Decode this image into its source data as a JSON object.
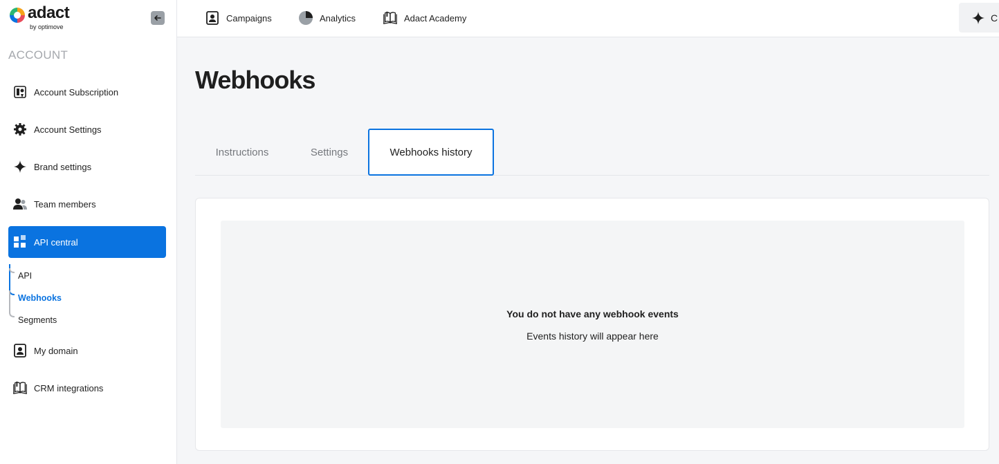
{
  "brand": {
    "name": "adact",
    "byline": "by optimove"
  },
  "sidebar": {
    "section_title": "ACCOUNT",
    "items": [
      {
        "label": "Account Subscription",
        "icon": "subscription-icon"
      },
      {
        "label": "Account Settings",
        "icon": "gear-icon"
      },
      {
        "label": "Brand settings",
        "icon": "sparkle-icon"
      },
      {
        "label": "Team members",
        "icon": "team-icon"
      },
      {
        "label": "API central",
        "icon": "grid-icon",
        "active": true
      },
      {
        "label": "My domain",
        "icon": "domain-icon"
      },
      {
        "label": "CRM integrations",
        "icon": "book-icon"
      }
    ],
    "subitems": [
      {
        "label": "API"
      },
      {
        "label": "Webhooks",
        "active": true
      },
      {
        "label": "Segments"
      }
    ]
  },
  "topbar": {
    "links": [
      {
        "label": "Campaigns",
        "icon": "campaigns-icon"
      },
      {
        "label": "Analytics",
        "icon": "pie-chart-icon"
      },
      {
        "label": "Adact Academy",
        "icon": "book-icon"
      }
    ],
    "ai_label": "C"
  },
  "page": {
    "title": "Webhooks",
    "tabs": [
      {
        "label": "Instructions"
      },
      {
        "label": "Settings"
      },
      {
        "label": "Webhooks history",
        "active": true
      }
    ],
    "empty_state": {
      "title": "You do not have any webhook events",
      "subtitle": "Events history will appear here"
    }
  },
  "colors": {
    "accent": "#0a73e0",
    "background": "#f5f6f8"
  }
}
